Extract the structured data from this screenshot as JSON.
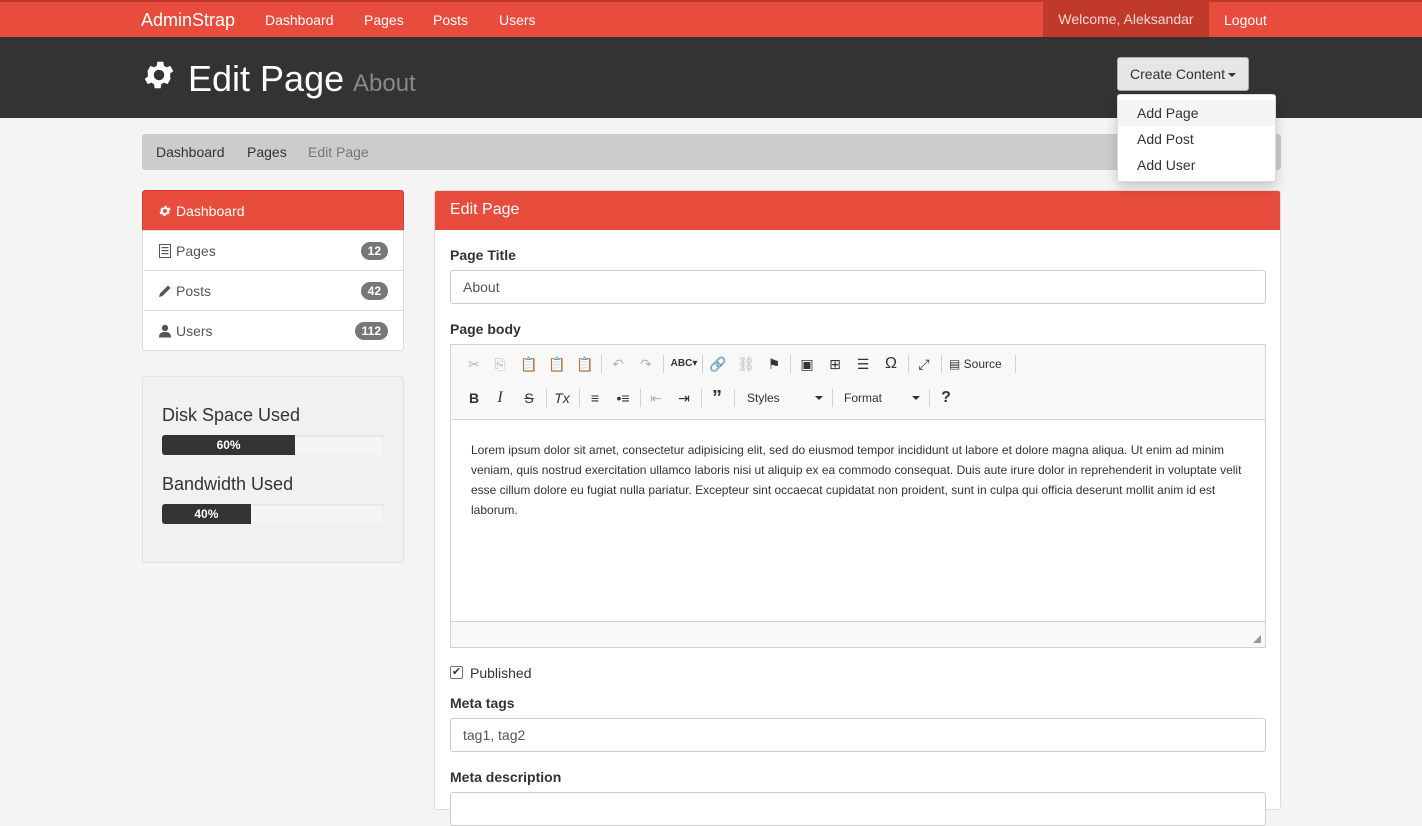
{
  "navbar": {
    "brand": "AdminStrap",
    "links": [
      "Dashboard",
      "Pages",
      "Posts",
      "Users"
    ],
    "welcome": "Welcome, Aleksandar",
    "logout": "Logout"
  },
  "header": {
    "icon": "gear-icon",
    "title": "Edit Page",
    "subtitle": "About",
    "create_button": "Create Content"
  },
  "dropdown": {
    "items": [
      "Add Page",
      "Add Post",
      "Add User"
    ]
  },
  "breadcrumb": {
    "items": [
      "Dashboard",
      "Pages",
      "Edit Page"
    ]
  },
  "sidebar": {
    "items": [
      {
        "label": "Dashboard",
        "icon": "gear-icon",
        "badge": ""
      },
      {
        "label": "Pages",
        "icon": "list-icon",
        "badge": "12"
      },
      {
        "label": "Posts",
        "icon": "pencil-icon",
        "badge": "42"
      },
      {
        "label": "Users",
        "icon": "user-icon",
        "badge": "112"
      }
    ]
  },
  "stats": {
    "disk_label": "Disk Space Used",
    "disk_text": "60%",
    "disk_value": 0.6,
    "bandwidth_label": "Bandwidth Used",
    "bandwidth_text": "40%",
    "bandwidth_value": 0.4
  },
  "panel": {
    "title": "Edit Page",
    "page_title_label": "Page Title",
    "page_title_value": "About",
    "page_body_label": "Page body",
    "body_text": "Lorem ipsum dolor sit amet, consectetur adipisicing elit, sed do eiusmod tempor incididunt ut labore et dolore magna aliqua. Ut enim ad minim veniam, quis nostrud exercitation ullamco laboris nisi ut aliquip ex ea commodo consequat. Duis aute irure dolor in reprehenderit in voluptate velit esse cillum dolore eu fugiat nulla pariatur. Excepteur sint occaecat cupidatat non proident, sunt in culpa qui officia deserunt mollit anim id est laborum.",
    "source_label": "Source",
    "styles_label": "Styles",
    "format_label": "Format",
    "published_label": "Published",
    "published_checked": true,
    "meta_tags_label": "Meta tags",
    "meta_tags_value": "tag1, tag2",
    "meta_description_label": "Meta description"
  },
  "colors": {
    "accent": "#e74c3c",
    "accent_dark": "#c0392b",
    "header_bg": "#333333"
  }
}
